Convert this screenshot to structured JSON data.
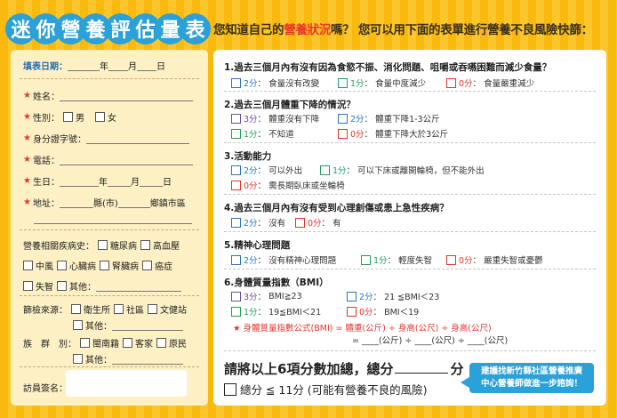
{
  "header": {
    "title_chars": [
      "迷",
      "你",
      "營",
      "養",
      "評",
      "估",
      "量",
      "表"
    ],
    "subtitle_pre": "您知道自己的",
    "subtitle_hl": "營養狀況",
    "subtitle_post": "嗎？ 您可以用下面的表單進行營養不良風險快篩："
  },
  "left": {
    "date_label": "填表日期：",
    "date_year": "年",
    "date_month": "月",
    "date_day": "日",
    "name": "姓名：",
    "gender": "性別：",
    "gender_m": "男",
    "gender_f": "女",
    "id": "身分證字號：",
    "phone": "電話：",
    "birth": "生日：",
    "birth_year": "年",
    "birth_month": "月",
    "birth_day": "日",
    "address": "地址：",
    "addr_county": "縣(市)",
    "addr_town": "鄉鎮市區",
    "disease_label": "營養相關疾病史：",
    "diseases_row1": [
      "糖尿病",
      "高血壓"
    ],
    "diseases_row2": [
      "中風",
      "心臟病",
      "腎臟病",
      "癌症"
    ],
    "diseases_row3": [
      "失智",
      "其他："
    ],
    "source_label": "篩檢來源：",
    "sources_row1": [
      "衛生所",
      "社區",
      "文健站"
    ],
    "sources_other": "其他：",
    "ethnic_label": "族　群　別：",
    "ethnic_row1": [
      "閩南籍",
      "客家",
      "原民"
    ],
    "ethnic_other": "其他：",
    "visitor": "訪員簽名："
  },
  "questions": {
    "q1": {
      "title": "1.過去三個月內有沒有因為食慾不振、消化問題、咀嚼或吞嚥困難而減少食量？",
      "opts": [
        {
          "score": "2分",
          "text": "食量沒有改變"
        },
        {
          "score": "1分",
          "text": "食量中度減少"
        },
        {
          "score": "0分",
          "text": "食量嚴重減少"
        }
      ]
    },
    "q2": {
      "title": "2.過去三個月體重下降的情況？",
      "opts": [
        {
          "score": "3分",
          "text": "體重沒有下降"
        },
        {
          "score": "2分",
          "text": "體重下降1-3公斤"
        },
        {
          "score": "1分",
          "text": "不知道"
        },
        {
          "score": "0分",
          "text": "體重下降大於3公斤"
        }
      ]
    },
    "q3": {
      "title": "3.活動能力",
      "opts": [
        {
          "score": "2分",
          "text": "可以外出"
        },
        {
          "score": "1分",
          "text": "可以下床或離開輪椅，但不能外出"
        },
        {
          "score": "0分",
          "text": "需長期臥床或坐輪椅"
        }
      ]
    },
    "q4": {
      "title": "4.過去三個月內有沒有受到心理創傷或患上急性疾病？",
      "opts": [
        {
          "score": "2分",
          "text": "沒有"
        },
        {
          "score": "0分",
          "text": "有"
        }
      ]
    },
    "q5": {
      "title": "5.精神心理問題",
      "opts": [
        {
          "score": "2分",
          "text": "沒有精神心理問題"
        },
        {
          "score": "1分",
          "text": "輕度失智"
        },
        {
          "score": "0分",
          "text": "嚴重失智或憂鬱"
        }
      ]
    },
    "q6": {
      "title": "6.身體質量指數（BMI）",
      "opts": [
        {
          "score": "3分",
          "text": "BMI≧23"
        },
        {
          "score": "2分",
          "text": "21 ≦BMI＜23"
        },
        {
          "score": "1分",
          "text": "19≦BMI＜21"
        },
        {
          "score": "0分",
          "text": "BMI＜19"
        }
      ],
      "formula": "★ 身體質量指數公式(BMI) = 體重(公斤) ÷ 身高(公尺) ÷ 身高(公尺)",
      "formula2": "= ____(公斤) ÷ ____(公尺) ÷ ____(公尺)"
    }
  },
  "total": {
    "pre": "請將以上6項分數加總，總分",
    "post": "分",
    "verdict": "總分 ≦ 11分 (可能有營養不良的風險)"
  },
  "callout": {
    "line1": "建議找新竹縣社區營養推廣",
    "line2": "中心營養師做進一步諮詢！"
  },
  "colors": {
    "accent_blue": "#2aa1d9",
    "option_blue": "#2a76c9",
    "option_green": "#22a05a",
    "option_red": "#e8352c",
    "option_purple": "#6b4ea2",
    "background_yellow": "#f9b90f"
  }
}
